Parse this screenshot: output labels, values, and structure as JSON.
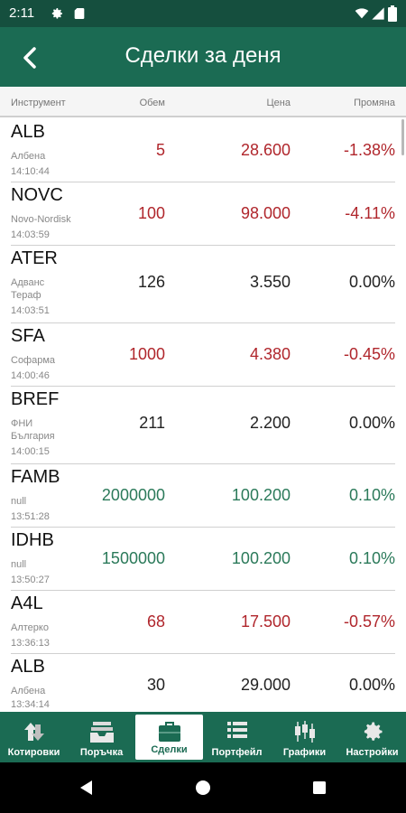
{
  "status": {
    "time": "2:11"
  },
  "appbar": {
    "title": "Сделки за деня"
  },
  "columns": {
    "instrument": "Инструмент",
    "volume": "Обем",
    "price": "Цена",
    "change": "Промяна"
  },
  "trades": [
    {
      "symbol": "ALB",
      "name": "Албена",
      "time": "14:10:44",
      "volume": "5",
      "price": "28.600",
      "change": "-1.38%",
      "trend": "down"
    },
    {
      "symbol": "NOVC",
      "name": "Novo-Nordisk",
      "time": "14:03:59",
      "volume": "100",
      "price": "98.000",
      "change": "-4.11%",
      "trend": "down"
    },
    {
      "symbol": "ATER",
      "name": "Адванс Тераф",
      "time": "14:03:51",
      "volume": "126",
      "price": "3.550",
      "change": "0.00%",
      "trend": "flat"
    },
    {
      "symbol": "SFA",
      "name": "Софарма",
      "time": "14:00:46",
      "volume": "1000",
      "price": "4.380",
      "change": "-0.45%",
      "trend": "down"
    },
    {
      "symbol": "BREF",
      "name": "ФНИ България",
      "time": "14:00:15",
      "volume": "211",
      "price": "2.200",
      "change": "0.00%",
      "trend": "flat"
    },
    {
      "symbol": "FAMB",
      "name": "null",
      "time": "13:51:28",
      "volume": "2000000",
      "price": "100.200",
      "change": "0.10%",
      "trend": "up"
    },
    {
      "symbol": "IDHB",
      "name": "null",
      "time": "13:50:27",
      "volume": "1500000",
      "price": "100.200",
      "change": "0.10%",
      "trend": "up"
    },
    {
      "symbol": "A4L",
      "name": "Алтерко",
      "time": "13:36:13",
      "volume": "68",
      "price": "17.500",
      "change": "-0.57%",
      "trend": "down"
    },
    {
      "symbol": "ALB",
      "name": "Албена",
      "time": "13:34:14",
      "volume": "30",
      "price": "29.000",
      "change": "0.00%",
      "trend": "flat"
    }
  ],
  "nav": [
    {
      "label": "Котировки",
      "icon": "quotes-icon",
      "active": false
    },
    {
      "label": "Поръчка",
      "icon": "order-tray-icon",
      "active": false
    },
    {
      "label": "Сделки",
      "icon": "briefcase-icon",
      "active": true
    },
    {
      "label": "Портфейл",
      "icon": "portfolio-list-icon",
      "active": false
    },
    {
      "label": "Графики",
      "icon": "candlestick-chart-icon",
      "active": false
    },
    {
      "label": "Настройки",
      "icon": "settings-gear-icon",
      "active": false
    }
  ],
  "colors": {
    "statusbar": "#154f3e",
    "primary": "#1b6b53",
    "down": "#b0262c",
    "up": "#2b7a5a"
  }
}
